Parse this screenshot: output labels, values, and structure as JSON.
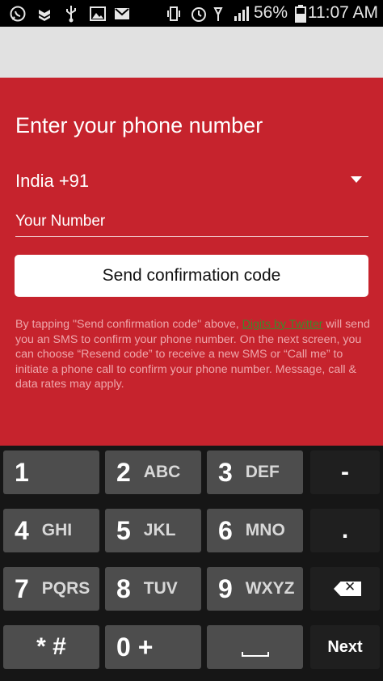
{
  "status_bar": {
    "icons": [
      "whatsapp-icon",
      "notification-icon",
      "usb-icon",
      "image-icon",
      "gmail-icon",
      "vibrate-icon",
      "alarm-icon",
      "signal-icon"
    ],
    "battery_percent": "56%",
    "time": "11:07 AM"
  },
  "form": {
    "title": "Enter your phone number",
    "country": "India +91",
    "phone_placeholder": "Your Number",
    "send_button": "Send confirmation code",
    "disclaimer_before": "By tapping \"Send confirmation code\" above, ",
    "disclaimer_link": "Digits by Twitter",
    "disclaimer_after": " will send you an SMS to confirm your phone number. On the next screen, you can choose “Resend code” to receive a new SMS or “Call me” to initiate a phone call to confirm your phone number. Message, call & data rates may apply."
  },
  "keyboard": {
    "keys": [
      {
        "num": "1",
        "letters": ""
      },
      {
        "num": "2",
        "letters": "ABC"
      },
      {
        "num": "3",
        "letters": "DEF"
      },
      {
        "num": "4",
        "letters": "GHI"
      },
      {
        "num": "5",
        "letters": "JKL"
      },
      {
        "num": "6",
        "letters": "MNO"
      },
      {
        "num": "7",
        "letters": "PQRS"
      },
      {
        "num": "8",
        "letters": "TUV"
      },
      {
        "num": "9",
        "letters": "WXYZ"
      },
      {
        "num": "* #",
        "letters": ""
      },
      {
        "num": "0 +",
        "letters": ""
      }
    ],
    "dash": "-",
    "dot": ".",
    "backspace": "✕",
    "next": "Next"
  }
}
